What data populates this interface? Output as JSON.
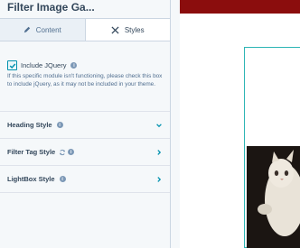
{
  "panel": {
    "title": "Filter Image Ga...",
    "tabs": [
      {
        "label": "Content",
        "icon": "pencil-icon",
        "active": false
      },
      {
        "label": "Styles",
        "icon": "brush-icon",
        "active": true
      }
    ],
    "include_jquery": {
      "label": "Include JQuery",
      "checked": true,
      "help": "If this specific module isn't functioning, please check this box to include jQuery, as it may not be included in your theme."
    },
    "sections": [
      {
        "label": "Heading Style",
        "expanded": true
      },
      {
        "label": "Filter Tag Style",
        "expanded": false,
        "has_sync_icon": true
      },
      {
        "label": "LightBox Style",
        "expanded": false
      }
    ]
  },
  "colors": {
    "accent": "#0091ae",
    "header_bar": "#8b0d0d",
    "frame_border": "#2db5b5"
  }
}
